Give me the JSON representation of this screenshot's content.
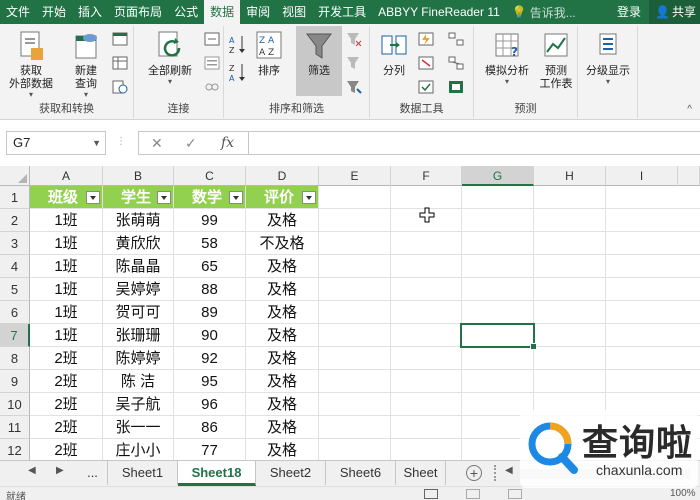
{
  "ribbon_tabs": [
    "文件",
    "开始",
    "插入",
    "页面布局",
    "公式",
    "数据",
    "审阅",
    "视图",
    "开发工具",
    "ABBYY FineReader 11"
  ],
  "active_tab": "数据",
  "tell_me": "告诉我...",
  "login": "登录",
  "share": "共享",
  "groups": {
    "get_transform": {
      "label": "获取和转换",
      "get_external_1": "获取",
      "get_external_2": "外部数据",
      "new_query_1": "新建",
      "new_query_2": "查询"
    },
    "connections": {
      "label": "连接",
      "refresh_all": "全部刷新"
    },
    "sort_filter": {
      "label": "排序和筛选",
      "sort": "排序",
      "filter": "筛选"
    },
    "data_tools": {
      "label": "数据工具",
      "text_to_columns": "分列"
    },
    "forecast": {
      "label": "预测",
      "what_if": "模拟分析",
      "forecast_sheet_1": "预测",
      "forecast_sheet_2": "工作表"
    },
    "outline": {
      "label": "",
      "group_show": "分级显示"
    }
  },
  "name_box": "G7",
  "formula_value": "",
  "columns": [
    "A",
    "B",
    "C",
    "D",
    "E",
    "F",
    "G",
    "H",
    "I"
  ],
  "selected_column": "G",
  "selected_row": "7",
  "rows": [
    "1",
    "2",
    "3",
    "4",
    "5",
    "6",
    "7",
    "8",
    "9",
    "10",
    "11",
    "12"
  ],
  "table_headers": [
    "班级",
    "学生",
    "数学",
    "评价"
  ],
  "table_rows": [
    [
      "1班",
      "张萌萌",
      "99",
      "及格"
    ],
    [
      "1班",
      "黄欣欣",
      "58",
      "不及格"
    ],
    [
      "1班",
      "陈晶晶",
      "65",
      "及格"
    ],
    [
      "1班",
      "吴婷婷",
      "88",
      "及格"
    ],
    [
      "1班",
      "贺可可",
      "89",
      "及格"
    ],
    [
      "1班",
      "张珊珊",
      "90",
      "及格"
    ],
    [
      "2班",
      "陈婷婷",
      "92",
      "及格"
    ],
    [
      "2班",
      "陈  洁",
      "95",
      "及格"
    ],
    [
      "2班",
      "吴子航",
      "96",
      "及格"
    ],
    [
      "2班",
      "张一一",
      "86",
      "及格"
    ],
    [
      "2班",
      "庄小小",
      "77",
      "及格"
    ]
  ],
  "sheet_tabs": [
    "...",
    "Sheet1",
    "Sheet18",
    "Sheet2",
    "Sheet6",
    "Sheet"
  ],
  "active_sheet": "Sheet18",
  "status_text": "就绪",
  "zoom": "100%",
  "watermark": {
    "text": "查询啦",
    "url": "chaxunla.com"
  },
  "colors": {
    "excel_green": "#217346",
    "header_fill": "#92d050"
  }
}
